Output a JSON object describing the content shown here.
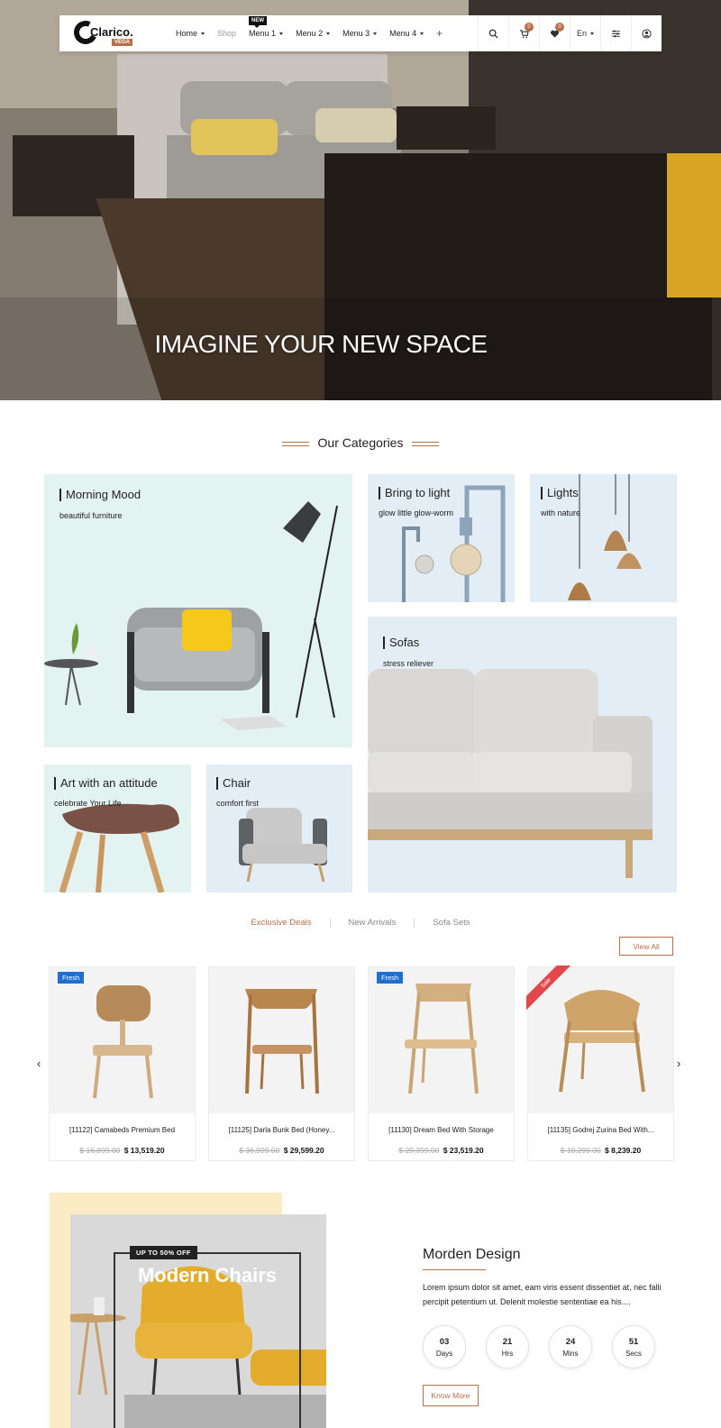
{
  "header": {
    "logo_text": "Clarico.",
    "logo_sub": "VEGA",
    "nav": [
      {
        "label": "Home",
        "dropdown": true
      },
      {
        "label": "Shop",
        "dropdown": false
      },
      {
        "label": "Menu 1",
        "dropdown": true,
        "badge": "NEW"
      },
      {
        "label": "Menu 2",
        "dropdown": true
      },
      {
        "label": "Menu 3",
        "dropdown": true
      },
      {
        "label": "Menu 4",
        "dropdown": true
      }
    ],
    "plus": "+",
    "cart_count": "0",
    "wishlist_count": "0",
    "language": "En"
  },
  "hero": {
    "title": "IMAGINE YOUR NEW SPACE"
  },
  "categories": {
    "title": "Our Categories",
    "items": [
      {
        "name": "Morning Mood",
        "sub": "beautiful furniture"
      },
      {
        "name": "Bring to light",
        "sub": "glow little glow-worm"
      },
      {
        "name": "Lights",
        "sub": "with nature"
      },
      {
        "name": "Sofas",
        "sub": "stress reliever"
      },
      {
        "name": "Art with an attitude",
        "sub": "celebrate Your Life"
      },
      {
        "name": "Chair",
        "sub": "comfort first"
      }
    ]
  },
  "tabs": [
    "Exclusive Deals",
    "New Arrivals",
    "Sofa Sets"
  ],
  "view_all": "View All",
  "arrows": {
    "prev": "‹",
    "next": "›"
  },
  "products": [
    {
      "name": "[11122] Camabeds Premium Bed",
      "old_price": "$ 16,899.00",
      "price": "$ 13,519.20",
      "badge": "Fresh"
    },
    {
      "name": "[11125] Darla Bunk Bed (Honey...",
      "old_price": "$ 36,999.00",
      "price": "$ 29,599.20",
      "badge": ""
    },
    {
      "name": "[11130] Dream Bed With Storage",
      "old_price": "$ 29,399.00",
      "price": "$ 23,519.20",
      "badge": "Fresh"
    },
    {
      "name": "[11135] Godrej Zurina Bed With...",
      "old_price": "$ 10,299.00",
      "price": "$ 8,239.20",
      "badge": "Sale"
    }
  ],
  "promo": {
    "tag": "UP TO 50% OFF",
    "title": "Modern Chairs",
    "design_title": "Morden Design",
    "design_text": "Lorem ipsum dolor sit amet, eam viris essent dissentiet at, nec falli percipit petentium ut. Delenit molestie sententiae ea his....",
    "countdown": [
      {
        "value": "03",
        "label": "Days"
      },
      {
        "value": "21",
        "label": "Hrs"
      },
      {
        "value": "24",
        "label": "Mins"
      },
      {
        "value": "51",
        "label": "Secs"
      }
    ],
    "button": "Know More"
  },
  "colors": {
    "accent": "#b8704a",
    "fresh": "#1f6fd0",
    "sale": "#e2474b"
  }
}
